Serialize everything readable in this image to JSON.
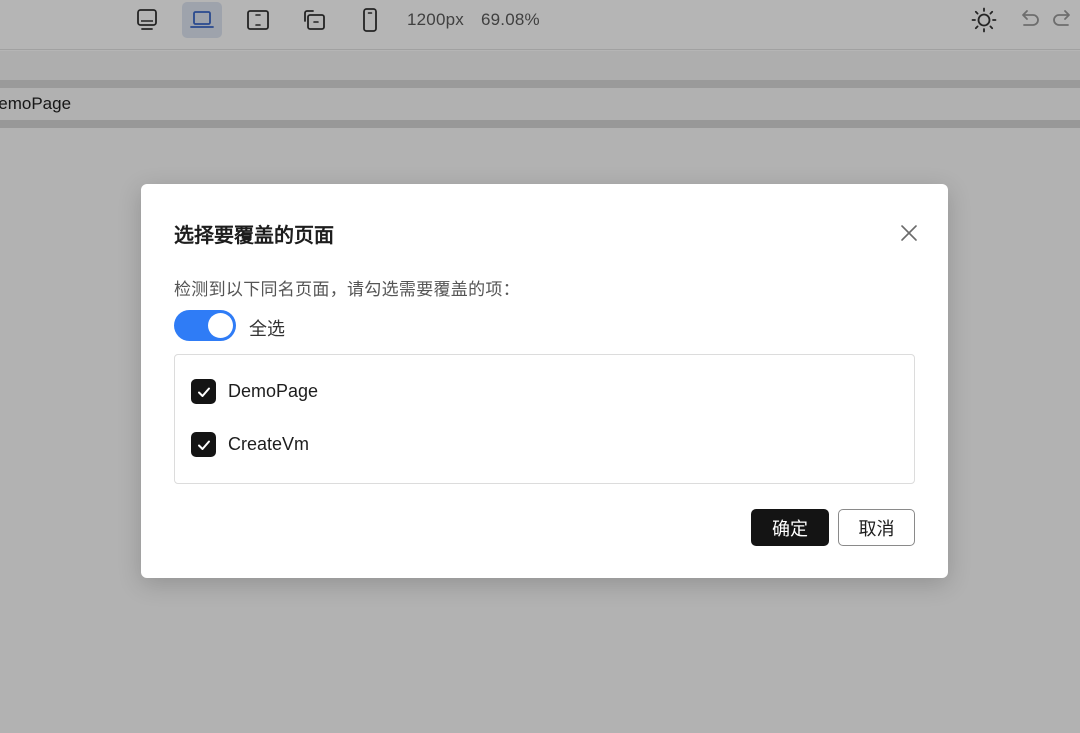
{
  "toolbar": {
    "device_buttons": [
      {
        "name": "desktop-monitor-icon",
        "active": false
      },
      {
        "name": "laptop-icon",
        "active": true
      },
      {
        "name": "tablet-landscape-icon",
        "active": false
      },
      {
        "name": "tablet-rotate-icon",
        "active": false
      },
      {
        "name": "mobile-phone-icon",
        "active": false
      }
    ],
    "width_value": "1200px",
    "zoom_value": "69.08%",
    "right_icons": [
      "sun-icon",
      "undo-icon",
      "redo-icon"
    ],
    "active_color": "#dfe6f3"
  },
  "page_bar": {
    "label": "DemoPage"
  },
  "modal": {
    "title": "选择要覆盖的页面",
    "description": "检测到以下同名页面，请勾选需要覆盖的项：",
    "select_all": {
      "label": "全选",
      "on": true,
      "color": "#2f7cf6"
    },
    "items": [
      {
        "label": "DemoPage",
        "checked": true
      },
      {
        "label": "CreateVm",
        "checked": true
      }
    ],
    "confirm_label": "确定",
    "cancel_label": "取消"
  }
}
